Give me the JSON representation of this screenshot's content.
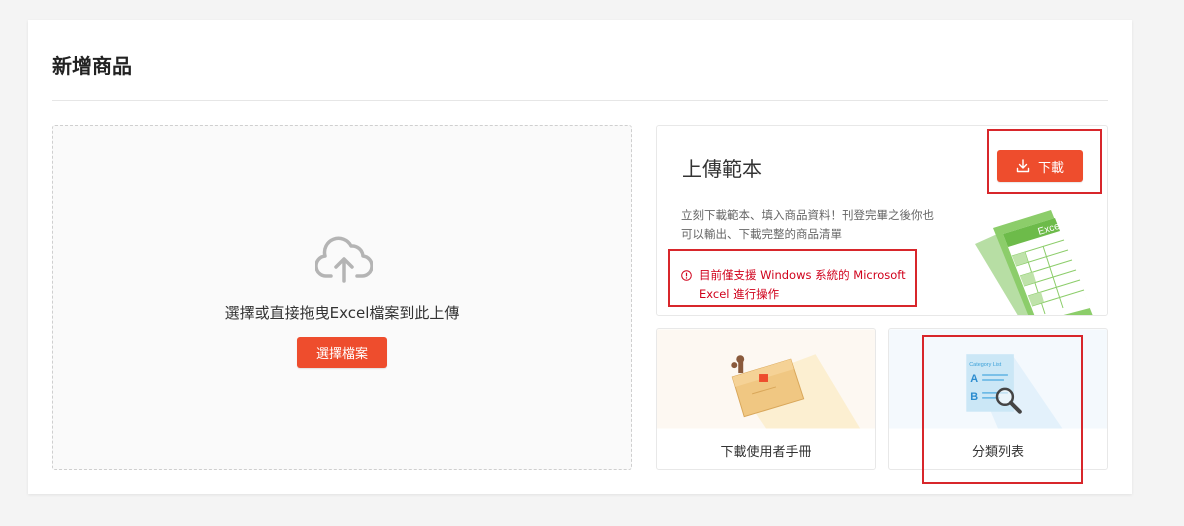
{
  "page": {
    "title": "新增商品"
  },
  "upload": {
    "hint": "選擇或直接拖曳Excel檔案到此上傳",
    "button_label": "選擇檔案",
    "icon": "cloud-upload-icon"
  },
  "template": {
    "title": "上傳範本",
    "download_label": "下載",
    "description": "立刻下載範本、填入商品資料！刊登完畢之後你也可以輸出、下載完整的商品清單",
    "warning": "目前僅支援 Windows 系統的 Microsoft Excel 進行操作",
    "illustration_label": "Excel"
  },
  "tiles": [
    {
      "label": "下載使用者手冊",
      "icon": "user-manual-folder-icon"
    },
    {
      "label": "分類列表",
      "icon": "category-list-icon",
      "illustration_title": "Category List",
      "illustration_letters": [
        "A",
        "B"
      ]
    }
  ],
  "colors": {
    "accent": "#ee4d2d",
    "warning": "#d0011b",
    "highlight_box": "#d8262b"
  }
}
